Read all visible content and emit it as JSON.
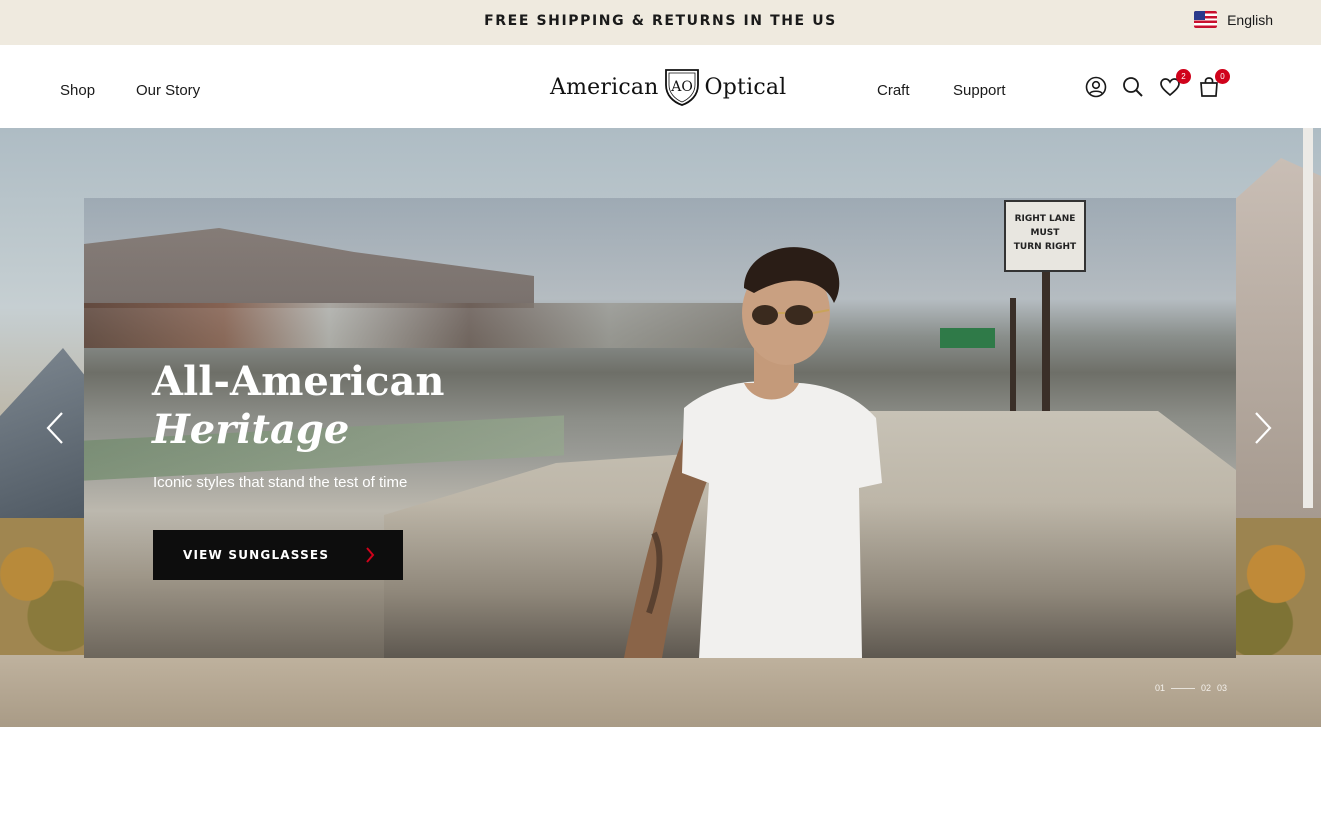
{
  "announcement": {
    "text": "FREE SHIPPING & RETURNS IN THE US",
    "language": "English",
    "flag_icon": "us-flag-icon"
  },
  "header": {
    "nav_left": [
      {
        "label": "Shop"
      },
      {
        "label": "Our Story"
      }
    ],
    "logo": {
      "left_word": "American",
      "right_word": "Optical",
      "crest_letters": "AO"
    },
    "nav_right": [
      {
        "label": "Craft"
      },
      {
        "label": "Support"
      }
    ],
    "icons": {
      "account": "user-icon",
      "search": "search-icon",
      "wishlist": "heart-icon",
      "cart": "shopping-bag-icon"
    },
    "wishlist_count": "2",
    "cart_count": "0",
    "badge_color": "#d0021b"
  },
  "hero": {
    "title_line1": "All-American",
    "title_line2": "Heritage",
    "subtitle": "Iconic styles that stand the test of time",
    "cta_label": "VIEW SUNGLASSES",
    "cta_arrow_color": "#d0021b",
    "sign_text": [
      "RIGHT LANE",
      "MUST",
      "TURN RIGHT"
    ],
    "pager": [
      "01",
      "02",
      "03"
    ],
    "current_slide": "02"
  }
}
